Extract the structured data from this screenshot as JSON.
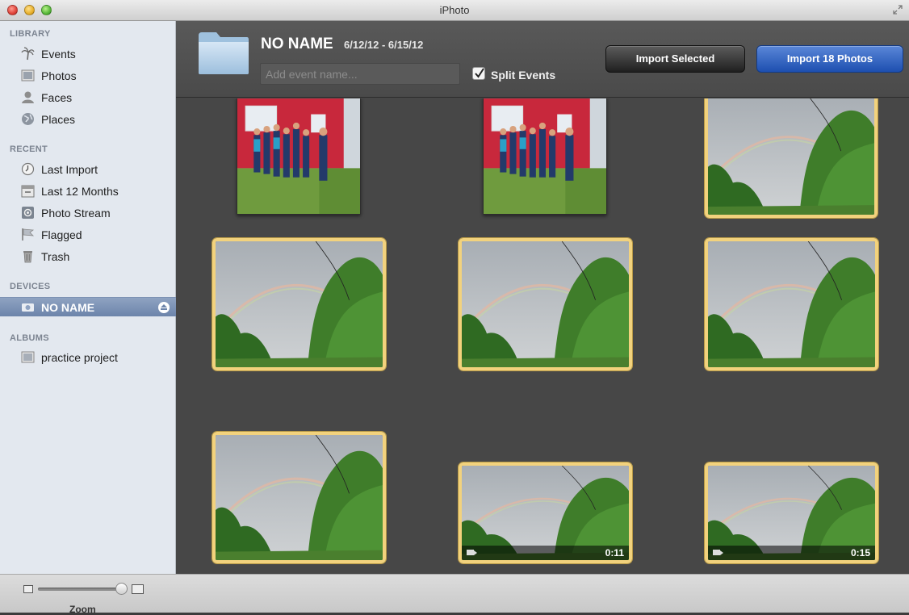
{
  "window": {
    "title": "iPhoto"
  },
  "sidebar": {
    "sections": [
      {
        "heading": "LIBRARY",
        "items": [
          {
            "label": "Events",
            "icon": "palm-tree-icon"
          },
          {
            "label": "Photos",
            "icon": "photos-icon"
          },
          {
            "label": "Faces",
            "icon": "faces-icon"
          },
          {
            "label": "Places",
            "icon": "globe-icon"
          }
        ]
      },
      {
        "heading": "RECENT",
        "items": [
          {
            "label": "Last Import",
            "icon": "clock-icon"
          },
          {
            "label": "Last 12 Months",
            "icon": "calendar-icon"
          },
          {
            "label": "Photo Stream",
            "icon": "photo-stream-icon"
          },
          {
            "label": "Flagged",
            "icon": "flag-icon"
          },
          {
            "label": "Trash",
            "icon": "trash-icon"
          }
        ]
      },
      {
        "heading": "DEVICES",
        "items": [
          {
            "label": "NO NAME",
            "icon": "camera-device-icon",
            "selected": true
          }
        ]
      },
      {
        "heading": "ALBUMS",
        "items": [
          {
            "label": "practice project",
            "icon": "album-icon"
          }
        ]
      }
    ]
  },
  "import_header": {
    "event_title": "NO NAME",
    "event_dates": "6/12/12 - 6/15/12",
    "event_name_placeholder": "Add event name...",
    "split_events_label": "Split Events",
    "split_events_checked": true,
    "import_selected_label": "Import Selected",
    "import_all_label": "Import 18 Photos"
  },
  "photos": [
    {
      "subject": "group-in-front-of-red-house",
      "selected": false
    },
    {
      "subject": "group-in-front-of-red-house",
      "selected": false
    },
    {
      "subject": "rainbow-over-trees",
      "selected": true
    },
    {
      "subject": "rainbow-over-trees",
      "selected": true
    },
    {
      "subject": "rainbow-over-trees",
      "selected": true
    },
    {
      "subject": "rainbow-over-trees",
      "selected": true
    },
    {
      "subject": "rainbow-over-trees-portrait",
      "selected": true
    },
    {
      "subject": "rainbow-video",
      "selected": true,
      "duration": "0:11"
    },
    {
      "subject": "rainbow-video",
      "selected": true,
      "duration": "0:15"
    }
  ],
  "bottom_bar": {
    "zoom_label": "Zoom",
    "zoom_level": 0.92
  },
  "colors": {
    "selection_border": "#f2d27d",
    "import_button": "#2a5fc2",
    "sidebar_selected": "#7a90b5"
  }
}
